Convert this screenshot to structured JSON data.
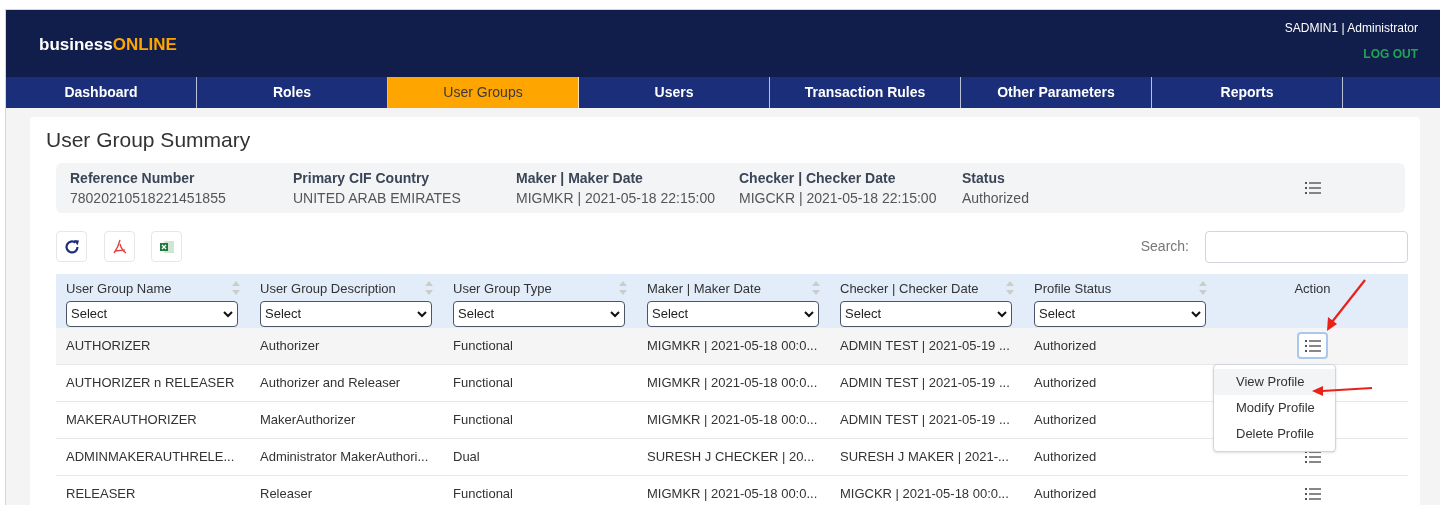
{
  "header": {
    "logo_prefix": "business",
    "logo_suffix": "ONLINE",
    "user": "SADMIN1 | Administrator",
    "logout": "LOG OUT"
  },
  "tabs": [
    {
      "label": "Dashboard",
      "selected": false
    },
    {
      "label": "Roles",
      "selected": false
    },
    {
      "label": "User Groups",
      "selected": true
    },
    {
      "label": "Users",
      "selected": false
    },
    {
      "label": "Transaction Rules",
      "selected": false
    },
    {
      "label": "Other Parameters",
      "selected": false
    },
    {
      "label": "Reports",
      "selected": false
    }
  ],
  "title": "User Group Summary",
  "summary": [
    {
      "label": "Reference Number",
      "value": "78020210518221451855"
    },
    {
      "label": "Primary CIF Country",
      "value": "UNITED ARAB EMIRATES"
    },
    {
      "label": "Maker | Maker Date",
      "value": "MIGMKR | 2021-05-18 22:15:00"
    },
    {
      "label": "Checker | Checker Date",
      "value": "MIGCKR | 2021-05-18 22:15:00"
    },
    {
      "label": "Status",
      "value": "Authorized"
    }
  ],
  "search": {
    "label": "Search:"
  },
  "table": {
    "columns": [
      {
        "label": "User Group Name",
        "filter": "Select"
      },
      {
        "label": "User Group Description",
        "filter": "Select"
      },
      {
        "label": "User Group Type",
        "filter": "Select"
      },
      {
        "label": "Maker | Maker Date",
        "filter": "Select"
      },
      {
        "label": "Checker | Checker Date",
        "filter": "Select"
      },
      {
        "label": "Profile Status",
        "filter": "Select"
      },
      {
        "label": "Action"
      }
    ],
    "rows": [
      {
        "cells": [
          "AUTHORIZER",
          "Authorizer",
          "Functional",
          "MIGMKR | 2021-05-18 00:0...",
          "ADMIN TEST | 2021-05-19 ...",
          "Authorized"
        ],
        "menu_open": true
      },
      {
        "cells": [
          "AUTHORIZER n RELEASER",
          "Authorizer and Releaser",
          "Functional",
          "MIGMKR | 2021-05-18 00:0...",
          "ADMIN TEST | 2021-05-19 ...",
          "Authorized"
        ],
        "menu_open": false
      },
      {
        "cells": [
          "MAKERAUTHORIZER",
          "MakerAuthorizer",
          "Functional",
          "MIGMKR | 2021-05-18 00:0...",
          "ADMIN TEST | 2021-05-19 ...",
          "Authorized"
        ],
        "menu_open": false
      },
      {
        "cells": [
          "ADMINMAKERAUTHRELE...",
          "Administrator MakerAuthori...",
          "Dual",
          "SURESH J CHECKER | 20...",
          "SURESH J MAKER | 2021-...",
          "Authorized"
        ],
        "menu_open": false
      },
      {
        "cells": [
          "RELEASER",
          "Releaser",
          "Functional",
          "MIGMKR | 2021-05-18 00:0...",
          "MIGCKR | 2021-05-18 00:0...",
          "Authorized"
        ],
        "menu_open": false
      }
    ]
  },
  "action_menu": [
    {
      "label": "View Profile",
      "selected": true
    },
    {
      "label": "Modify Profile",
      "selected": false
    },
    {
      "label": "Delete Profile",
      "selected": false
    }
  ]
}
